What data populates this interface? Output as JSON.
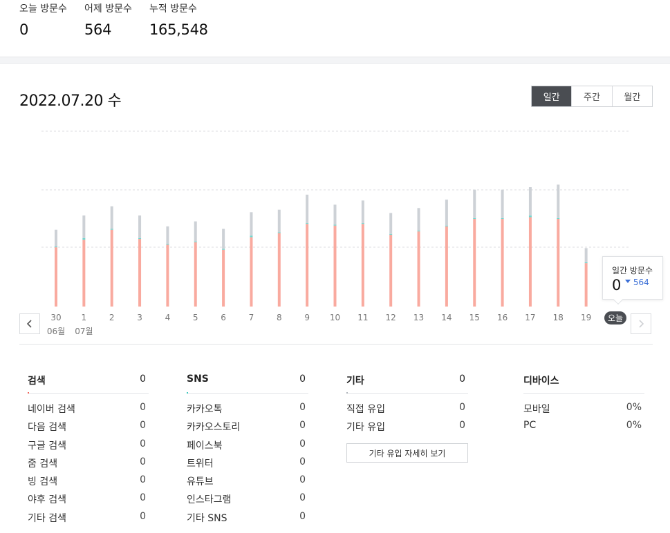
{
  "stats": [
    {
      "label": "오늘 방문수",
      "value": "0"
    },
    {
      "label": "어제 방문수",
      "value": "564"
    },
    {
      "label": "누적 방문수",
      "value": "165,548"
    }
  ],
  "date_title": "2022.07.20 수",
  "period_tabs": [
    "일간",
    "주간",
    "월간"
  ],
  "active_period": "일간",
  "chart_data": {
    "type": "bar",
    "stacked": true,
    "categories": [
      "30",
      "1",
      "2",
      "3",
      "4",
      "5",
      "6",
      "7",
      "8",
      "9",
      "10",
      "11",
      "12",
      "13",
      "14",
      "15",
      "16",
      "17",
      "18",
      "19",
      "오늘"
    ],
    "month_labels": [
      {
        "under": "30",
        "label": "06월"
      },
      {
        "under": "1",
        "label": "07월"
      }
    ],
    "series": [
      {
        "color": "#f9aa9f",
        "values": [
          355,
          400,
          460,
          405,
          370,
          385,
          340,
          415,
          440,
          495,
          485,
          495,
          430,
          450,
          480,
          525,
          525,
          535,
          525,
          260,
          0
        ]
      },
      {
        "color": "#6fd7cf",
        "values": [
          5,
          10,
          5,
          5,
          5,
          5,
          5,
          10,
          5,
          5,
          5,
          5,
          5,
          5,
          5,
          5,
          5,
          10,
          5,
          5,
          0
        ]
      },
      {
        "color": "#cdd1d6",
        "values": [
          100,
          135,
          135,
          135,
          105,
          120,
          120,
          140,
          135,
          170,
          120,
          135,
          125,
          135,
          155,
          170,
          170,
          170,
          200,
          85,
          0
        ]
      }
    ],
    "ylim": [
      0,
      1050
    ],
    "grid": true,
    "tooltip": {
      "label": "일간 방문수",
      "value": "0",
      "compare_value": "564",
      "compare_icon": "caret-down-icon"
    },
    "today_badge": "오늘"
  },
  "nav": {
    "prev_icon": "chevron-left-icon",
    "next_icon": "chevron-right-icon"
  },
  "sources": [
    {
      "title": "검색",
      "total": "0",
      "marker_color": "#f0645a",
      "items": [
        {
          "label": "네이버 검색",
          "value": "0"
        },
        {
          "label": "다음 검색",
          "value": "0"
        },
        {
          "label": "구글 검색",
          "value": "0"
        },
        {
          "label": "줌 검색",
          "value": "0"
        },
        {
          "label": "빙 검색",
          "value": "0"
        },
        {
          "label": "야후 검색",
          "value": "0"
        },
        {
          "label": "기타 검색",
          "value": "0"
        }
      ]
    },
    {
      "title": "SNS",
      "total": "0",
      "marker_color": "#40c8be",
      "items": [
        {
          "label": "카카오톡",
          "value": "0"
        },
        {
          "label": "카카오스토리",
          "value": "0"
        },
        {
          "label": "페이스북",
          "value": "0"
        },
        {
          "label": "트위터",
          "value": "0"
        },
        {
          "label": "유튜브",
          "value": "0"
        },
        {
          "label": "인스타그램",
          "value": "0"
        },
        {
          "label": "기타 SNS",
          "value": "0"
        }
      ]
    },
    {
      "title": "기타",
      "total": "0",
      "marker_color": "#b0b5bb",
      "items": [
        {
          "label": "직접 유입",
          "value": "0"
        },
        {
          "label": "기타 유입",
          "value": "0"
        }
      ],
      "detail_button": "기타 유입 자세히 보기"
    },
    {
      "title": "디바이스",
      "total": "",
      "marker_color": "",
      "items": [
        {
          "label": "모바일",
          "value": "0%"
        },
        {
          "label": "PC",
          "value": "0%"
        }
      ]
    }
  ]
}
